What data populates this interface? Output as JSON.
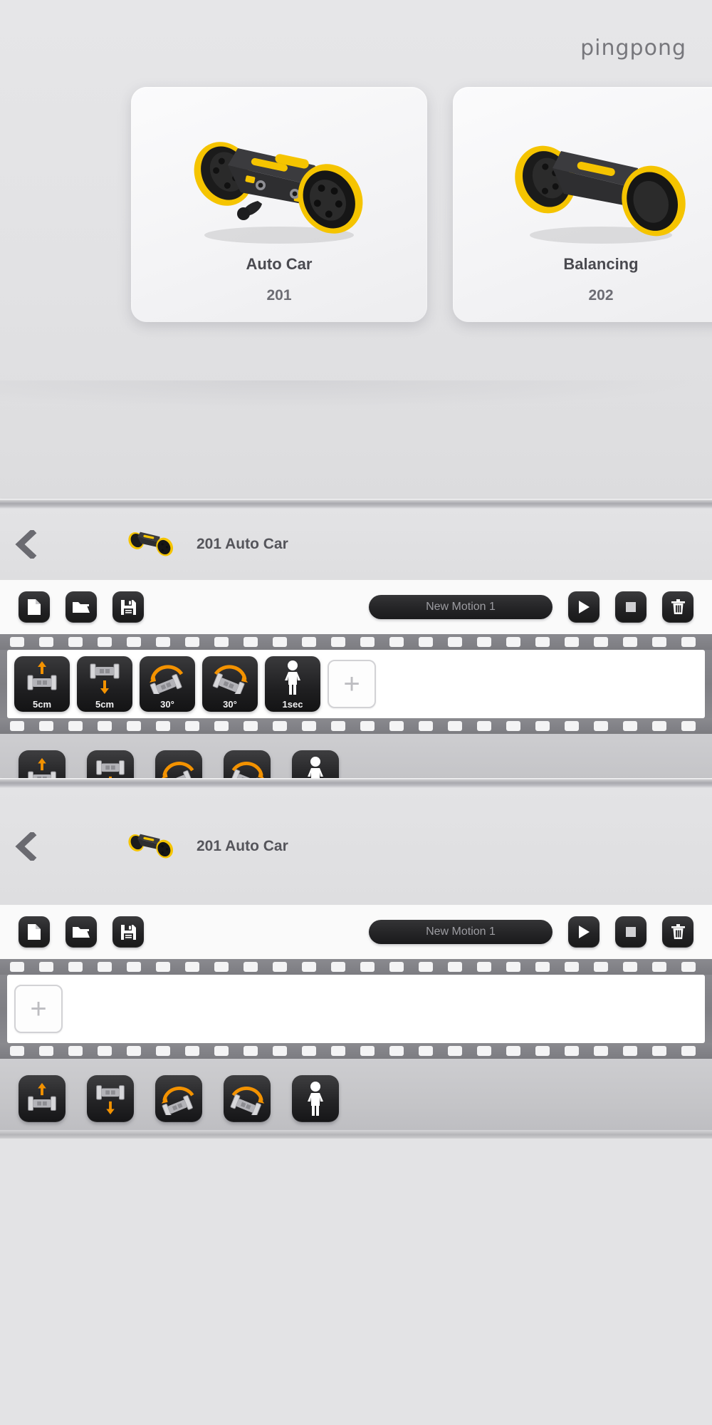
{
  "brand": {
    "logo_text": "pingpong"
  },
  "chooser": {
    "cards": [
      {
        "name": "Auto Car",
        "number": "201",
        "icon": "robot-auto-car-icon"
      },
      {
        "name": "Balancing",
        "number": "202",
        "icon": "robot-balancing-icon"
      }
    ]
  },
  "editors": [
    {
      "back_icon": "chevron-left-icon",
      "thumb_icon": "robot-thumbnail-icon",
      "title": "201 Auto Car",
      "toolbar": {
        "new_label": "new-file",
        "open_label": "open-folder",
        "save_label": "save-disk",
        "motion_name": "New Motion 1",
        "play_label": "play",
        "stop_label": "stop",
        "delete_label": "delete"
      },
      "timeline": {
        "frames": [
          {
            "label": "5cm",
            "glyph": "move-forward-icon"
          },
          {
            "label": "5cm",
            "glyph": "move-backward-icon"
          },
          {
            "label": "30°",
            "glyph": "turn-left-icon"
          },
          {
            "label": "30°",
            "glyph": "turn-right-icon"
          },
          {
            "label": "1sec",
            "glyph": "wait-person-icon"
          }
        ],
        "add_label": "+"
      },
      "palette": [
        {
          "glyph": "move-forward-icon"
        },
        {
          "glyph": "move-backward-icon"
        },
        {
          "glyph": "turn-left-icon"
        },
        {
          "glyph": "turn-right-icon"
        },
        {
          "glyph": "wait-person-icon"
        }
      ]
    },
    {
      "back_icon": "chevron-left-icon",
      "thumb_icon": "robot-thumbnail-icon",
      "title": "201 Auto Car",
      "toolbar": {
        "new_label": "new-file",
        "open_label": "open-folder",
        "save_label": "save-disk",
        "motion_name": "New Motion 1",
        "play_label": "play",
        "stop_label": "stop",
        "delete_label": "delete"
      },
      "timeline": {
        "frames": [],
        "add_label": "+"
      },
      "palette": [
        {
          "glyph": "move-forward-icon"
        },
        {
          "glyph": "move-backward-icon"
        },
        {
          "glyph": "turn-left-icon"
        },
        {
          "glyph": "turn-right-icon"
        },
        {
          "glyph": "wait-person-icon"
        }
      ]
    }
  ],
  "colors": {
    "accent_orange": "#F39200",
    "robot_yellow": "#F5C400",
    "panel_dark": "#1f1f21",
    "page_bg": "#e3e3e5"
  }
}
